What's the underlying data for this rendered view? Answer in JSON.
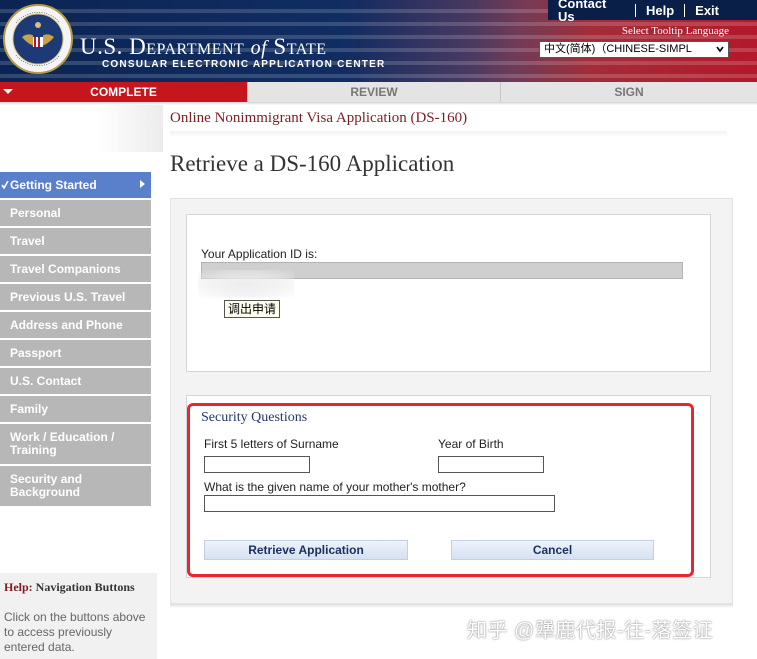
{
  "header": {
    "seal_text": "DEPARTMENT OF STATE · UNITED STATES OF AMERICA",
    "dept_title_prefix": "U.S. Department ",
    "dept_title_of": "of",
    "dept_title_suffix": " State",
    "dept_subtitle": "CONSULAR ELECTRONIC APPLICATION CENTER",
    "links": [
      "Contact Us",
      "Help",
      "Exit"
    ],
    "tooltip_language_label": "Select Tooltip Language",
    "language_selected": "中文(简体)（CHINESE-SIMPL"
  },
  "progress": {
    "tabs": [
      {
        "label": "COMPLETE",
        "active": true
      },
      {
        "label": "REVIEW",
        "active": false
      },
      {
        "label": "SIGN",
        "active": false
      }
    ]
  },
  "sidebar": {
    "items": [
      {
        "label": "Getting Started",
        "active": true
      },
      {
        "label": "Personal"
      },
      {
        "label": "Travel"
      },
      {
        "label": "Travel Companions"
      },
      {
        "label": "Previous U.S. Travel"
      },
      {
        "label": "Address and Phone"
      },
      {
        "label": "Passport"
      },
      {
        "label": "U.S. Contact"
      },
      {
        "label": "Family"
      },
      {
        "label": "Work / Education / Training"
      },
      {
        "label": "Security and Background"
      }
    ],
    "help": {
      "title_highlight": "Help:",
      "title_rest": " Navigation Buttons",
      "text": "Click on the buttons above to access previously entered data."
    }
  },
  "main": {
    "application_title": "Online Nonimmigrant Visa Application (DS-160)",
    "page_title": "Retrieve a DS-160 Application",
    "application_id_label": "Your Application ID is:",
    "retrieve_chip_label": "调出申请",
    "security": {
      "title": "Security Questions",
      "surname_label": "First 5 letters of Surname",
      "surname_value": "",
      "year_label": "Year of Birth",
      "year_value": "",
      "mother_label": "What is the given name of your mother's mother?",
      "mother_value": "",
      "retrieve_button": "Retrieve Application",
      "cancel_button": "Cancel"
    }
  },
  "watermark": "知乎 @犟鹿代报-往-落签证",
  "colors": {
    "progress_active": "#c4161c",
    "nav_active": "#5a7fcb",
    "nav_inactive": "#b7b7b7",
    "title_maroon": "#7a1e21",
    "highlight_frame": "#e8262e"
  }
}
